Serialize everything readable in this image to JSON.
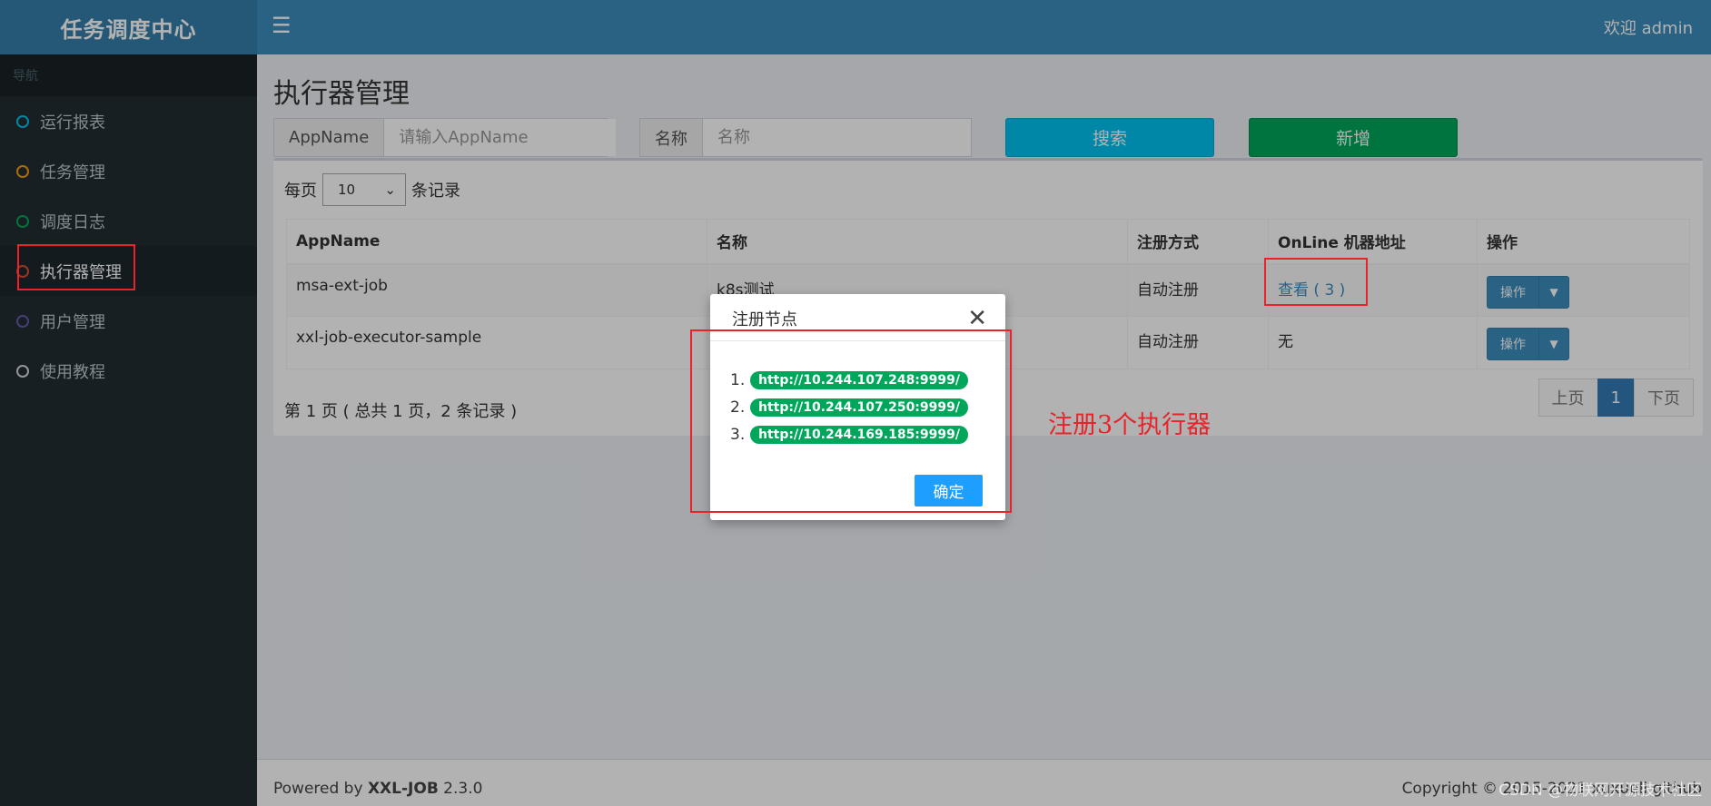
{
  "app": {
    "title": "任务调度中心",
    "welcome": "欢迎 admin"
  },
  "sidebar": {
    "header": "导航",
    "items": [
      {
        "label": "运行报表",
        "color": "#00c0ef"
      },
      {
        "label": "任务管理",
        "color": "#f39c12"
      },
      {
        "label": "调度日志",
        "color": "#00a65a"
      },
      {
        "label": "执行器管理",
        "color": "#dd4b39"
      },
      {
        "label": "用户管理",
        "color": "#605ca8"
      },
      {
        "label": "使用教程",
        "color": "#d2d6de"
      }
    ]
  },
  "main": {
    "title": "执行器管理",
    "filters": {
      "appname_label": "AppName",
      "appname_placeholder": "请输入AppName",
      "name_label": "名称",
      "name_placeholder": "名称"
    },
    "search_label": "搜索",
    "add_label": "新增",
    "page_size": {
      "prefix": "每页",
      "value": "10",
      "suffix": "条记录"
    },
    "table": {
      "headers": [
        "AppName",
        "名称",
        "注册方式",
        "OnLine 机器地址",
        "操作"
      ],
      "rows": [
        {
          "appname": "msa-ext-job",
          "name": "k8s测试",
          "reg": "自动注册",
          "online": "查看 ( 3 )",
          "op": "操作"
        },
        {
          "appname": "xxl-job-executor-sample",
          "name": "",
          "reg": "自动注册",
          "online": "无",
          "op": "操作"
        }
      ]
    },
    "pager_info": "第 1 页 ( 总共 1 页，2 条记录 )",
    "pager": {
      "prev": "上页",
      "current": "1",
      "next": "下页"
    }
  },
  "footer": {
    "powered_prefix": "Powered by ",
    "product": "XXL-JOB",
    "version": " 2.3.0",
    "copyright": "Copyright © 2015-2021 xuxueli  github"
  },
  "modal": {
    "title": "注册节点",
    "nodes": [
      "http://10.244.107.248:9999/",
      "http://10.244.107.250:9999/",
      "http://10.244.169.185:9999/"
    ],
    "ok_label": "确定"
  },
  "annotation": {
    "text": "注册3个执行器",
    "color": "#e8232a"
  },
  "watermark": "CSDN @物联网开源技术社区"
}
